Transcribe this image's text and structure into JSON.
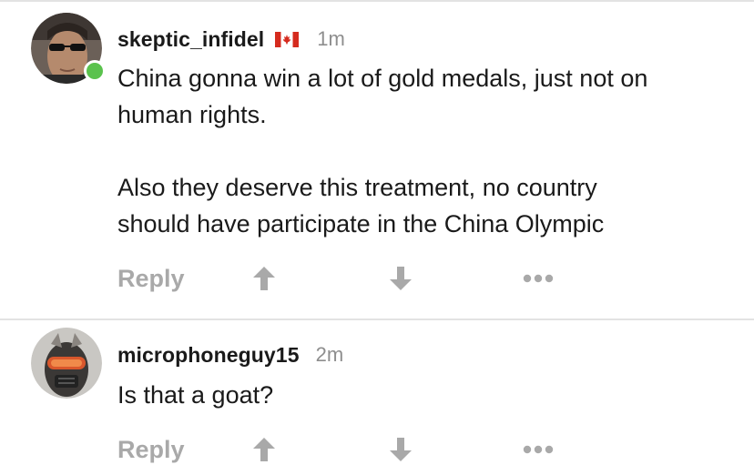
{
  "comments": [
    {
      "username": "skeptic_infidel",
      "flag_icon": "canada-flag-icon",
      "time": "1m",
      "online": true,
      "body": "China gonna win a lot of gold medals, just not on\nhuman rights.\n\nAlso they deserve this treatment, no country\nshould have participate in the China Olympic",
      "reply_label": "Reply"
    },
    {
      "username": "microphoneguy15",
      "time": "2m",
      "online": false,
      "body": "Is that a goat?",
      "reply_label": "Reply"
    }
  ],
  "colors": {
    "action_gray": "#a9a9a9",
    "time_gray": "#8e8e8e",
    "online_green": "#5ac24d",
    "divider": "#e3e3e3"
  }
}
